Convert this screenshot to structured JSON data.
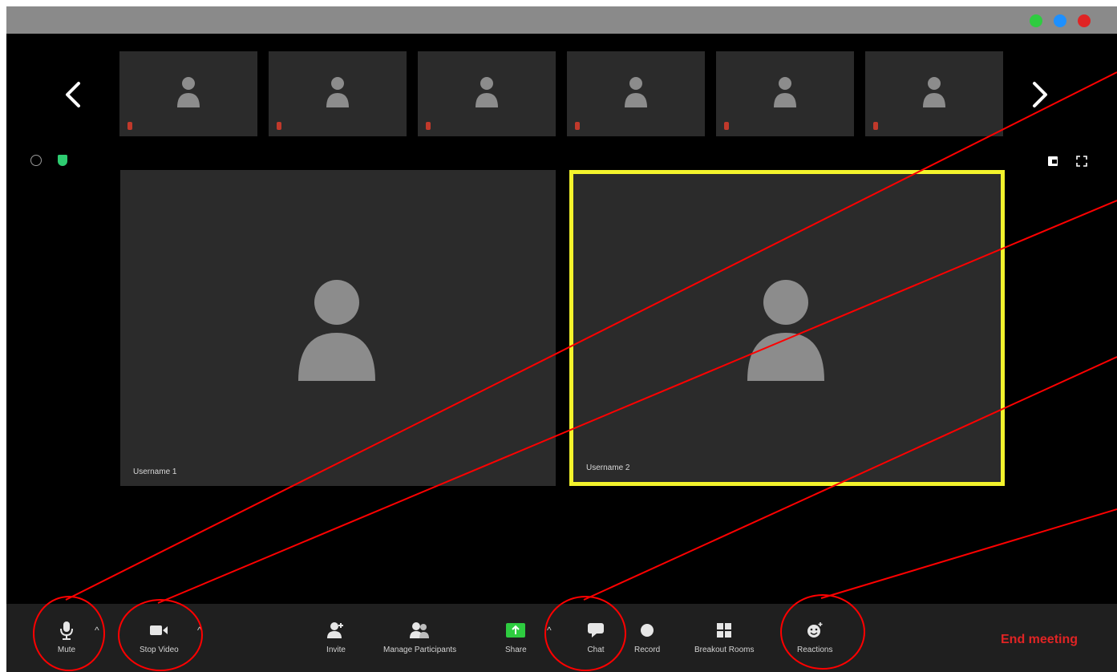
{
  "participants_strip": {
    "count": 6
  },
  "tiles": [
    {
      "username": "Username 1"
    },
    {
      "username": "Username 2"
    }
  ],
  "toolbar": {
    "mute": "Mute",
    "stop_video": "Stop Video",
    "invite": "Invite",
    "manage_participants": "Manage Participants",
    "share": "Share",
    "chat": "Chat",
    "record": "Record",
    "breakout_rooms": "Breakout Rooms",
    "reactions": "Reactions",
    "end_meeting": "End meeting"
  },
  "icons": {
    "titlebar": [
      "green-dot-icon",
      "blue-dot-icon",
      "red-dot-icon"
    ],
    "nav": [
      "chevron-left-icon",
      "chevron-right-icon"
    ],
    "info": [
      "info-icon",
      "shield-icon"
    ],
    "view": [
      "view-icon",
      "fullscreen-icon"
    ],
    "toolbar": [
      "microphone-icon",
      "video-camera-icon",
      "add-person-icon",
      "participants-icon",
      "share-screen-icon",
      "chat-bubble-icon",
      "record-icon",
      "grid-icon",
      "emoji-plus-icon"
    ]
  },
  "colors": {
    "active_speaker_border": "#f3f32c",
    "share": "#2ecc40",
    "end_meeting": "#e02424",
    "annotation": "#ff0000",
    "titlebar_green": "#2ecc40",
    "titlebar_blue": "#1e90ff",
    "titlebar_red": "#e02424"
  }
}
